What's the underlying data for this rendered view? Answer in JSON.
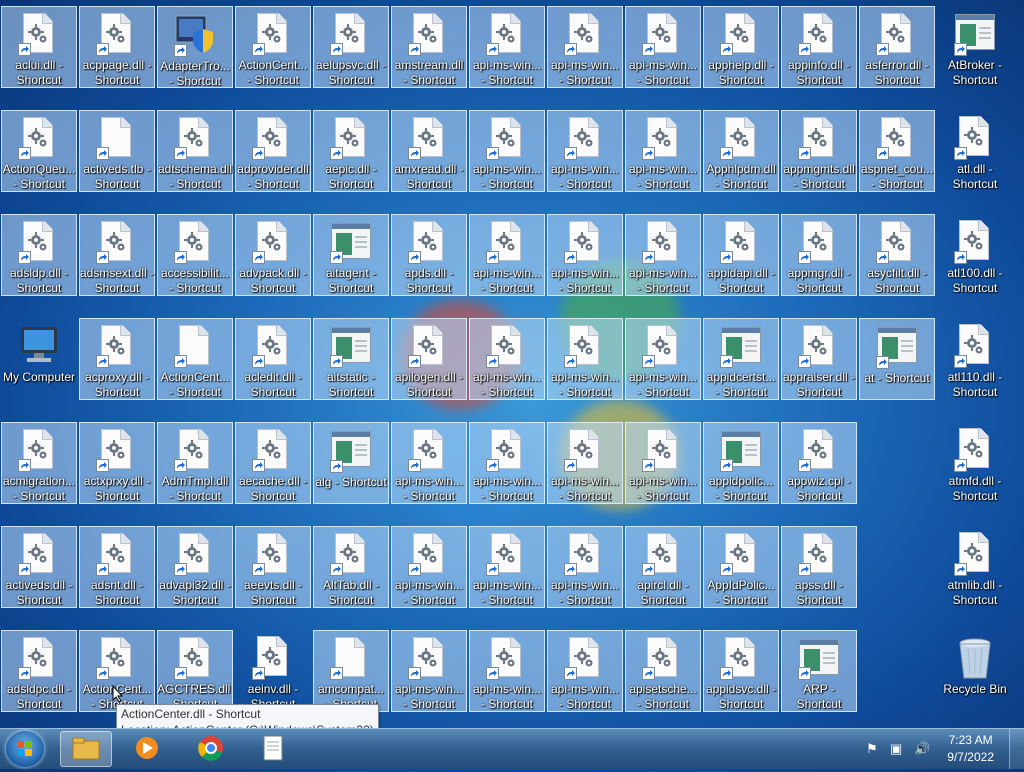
{
  "desktop": {
    "columns": [
      [
        {
          "name": "aclui.dll - Shortcut",
          "l1": "aclui.dll -",
          "l2": "Shortcut",
          "icon": "dll-gear",
          "sel": true
        },
        {
          "name": "ActionQueue... - Shortcut",
          "l1": "ActionQueu...",
          "l2": "- Shortcut",
          "icon": "dll-gear",
          "sel": true
        },
        {
          "name": "adsldp.dll - Shortcut",
          "l1": "adsldp.dll -",
          "l2": "Shortcut",
          "icon": "dll-gear",
          "sel": true
        },
        {
          "name": "My Computer",
          "l1": "My Computer",
          "l2": "",
          "icon": "computer",
          "sel": false,
          "noarrow": true
        },
        {
          "name": "acmigration... - Shortcut",
          "l1": "acmigration...",
          "l2": "- Shortcut",
          "icon": "dll-gear",
          "sel": true
        },
        {
          "name": "activeds.dll - Shortcut",
          "l1": "activeds.dll -",
          "l2": "Shortcut",
          "icon": "dll-gear",
          "sel": true
        },
        {
          "name": "adsldpc.dll - Shortcut",
          "l1": "adsldpc.dll -",
          "l2": "Shortcut",
          "icon": "dll-gear",
          "sel": true
        }
      ],
      [
        {
          "l1": "acppage.dll -",
          "l2": "Shortcut",
          "icon": "dll-gear",
          "sel": true
        },
        {
          "l1": "activeds.tlb -",
          "l2": "Shortcut",
          "icon": "blank",
          "sel": true
        },
        {
          "l1": "adsmsext.dll -",
          "l2": "Shortcut",
          "icon": "dll-gear",
          "sel": true
        },
        {
          "l1": "acproxy.dll -",
          "l2": "Shortcut",
          "icon": "dll-gear",
          "sel": true
        },
        {
          "l1": "actxprxy.dll -",
          "l2": "Shortcut",
          "icon": "dll-gear",
          "sel": true
        },
        {
          "l1": "adsnt.dll -",
          "l2": "Shortcut",
          "icon": "dll-gear",
          "sel": true
        },
        {
          "l1": "ActionCent...",
          "l2": "- Shortcut",
          "icon": "dll-gear",
          "sel": true
        }
      ],
      [
        {
          "l1": "AdapterTro...",
          "l2": "- Shortcut",
          "icon": "shield",
          "sel": true
        },
        {
          "l1": "adtschema.dll",
          "l2": "- Shortcut",
          "icon": "dll-gear",
          "sel": true
        },
        {
          "l1": "accessibilit...",
          "l2": "- Shortcut",
          "icon": "dll-gear",
          "sel": true
        },
        {
          "l1": "ActionCent...",
          "l2": "- Shortcut",
          "icon": "blank",
          "sel": true
        },
        {
          "l1": "AdmTmpl.dll",
          "l2": "- Shortcut",
          "icon": "dll-gear",
          "sel": true
        },
        {
          "l1": "advapi32.dll -",
          "l2": "Shortcut",
          "icon": "dll-gear",
          "sel": true
        },
        {
          "l1": "AGCTRES.dll -",
          "l2": "Shortcut",
          "icon": "dll-gear",
          "sel": true
        }
      ],
      [
        {
          "l1": "ActionCent...",
          "l2": "- Shortcut",
          "icon": "dll-gear",
          "sel": true
        },
        {
          "l1": "adprovider.dll",
          "l2": "- Shortcut",
          "icon": "dll-gear",
          "sel": true
        },
        {
          "l1": "advpack.dll -",
          "l2": "Shortcut",
          "icon": "dll-gear",
          "sel": true
        },
        {
          "l1": "acledit.dll -",
          "l2": "Shortcut",
          "icon": "dll-gear",
          "sel": true
        },
        {
          "l1": "aecache.dll -",
          "l2": "Shortcut",
          "icon": "dll-gear",
          "sel": true
        },
        {
          "l1": "aeevts.dll -",
          "l2": "Shortcut",
          "icon": "dll-gear",
          "sel": true
        },
        {
          "l1": "aeinv.dll -",
          "l2": "Shortcut",
          "icon": "dll-gear",
          "sel": false
        }
      ],
      [
        {
          "l1": "aelupsvc.dll -",
          "l2": "Shortcut",
          "icon": "dll-gear",
          "sel": true
        },
        {
          "l1": "aepic.dll -",
          "l2": "Shortcut",
          "icon": "dll-gear",
          "sel": true
        },
        {
          "l1": "aitagent -",
          "l2": "Shortcut",
          "icon": "window",
          "sel": true
        },
        {
          "l1": "aitstatic -",
          "l2": "Shortcut",
          "icon": "window",
          "sel": true
        },
        {
          "l1": "alg - Shortcut",
          "l2": "",
          "icon": "window",
          "sel": true
        },
        {
          "l1": "AltTab.dll -",
          "l2": "Shortcut",
          "icon": "dll-gear",
          "sel": true
        },
        {
          "l1": "amcompat...",
          "l2": "- Shortcut",
          "icon": "blank",
          "sel": true
        }
      ],
      [
        {
          "l1": "amstream.dll",
          "l2": "- Shortcut",
          "icon": "dll-gear",
          "sel": true
        },
        {
          "l1": "amxread.dll -",
          "l2": "Shortcut",
          "icon": "dll-gear",
          "sel": true
        },
        {
          "l1": "apds.dll -",
          "l2": "Shortcut",
          "icon": "dll-gear",
          "sel": true
        },
        {
          "l1": "apilogen.dll -",
          "l2": "Shortcut",
          "icon": "dll-gear",
          "sel": true
        },
        {
          "l1": "api-ms-win...",
          "l2": "- Shortcut",
          "icon": "dll-gear",
          "sel": true
        },
        {
          "l1": "api-ms-win...",
          "l2": "- Shortcut",
          "icon": "dll-gear",
          "sel": true
        },
        {
          "l1": "api-ms-win...",
          "l2": "- Shortcut",
          "icon": "dll-gear",
          "sel": true
        }
      ],
      [
        {
          "l1": "api-ms-win...",
          "l2": "- Shortcut",
          "icon": "dll-gear",
          "sel": true
        },
        {
          "l1": "api-ms-win...",
          "l2": "- Shortcut",
          "icon": "dll-gear",
          "sel": true
        },
        {
          "l1": "api-ms-win...",
          "l2": "- Shortcut",
          "icon": "dll-gear",
          "sel": true
        },
        {
          "l1": "api-ms-win...",
          "l2": "- Shortcut",
          "icon": "dll-gear",
          "sel": true
        },
        {
          "l1": "api-ms-win...",
          "l2": "- Shortcut",
          "icon": "dll-gear",
          "sel": true
        },
        {
          "l1": "api-ms-win...",
          "l2": "- Shortcut",
          "icon": "dll-gear",
          "sel": true
        },
        {
          "l1": "api-ms-win...",
          "l2": "- Shortcut",
          "icon": "dll-gear",
          "sel": true
        }
      ],
      [
        {
          "l1": "api-ms-win...",
          "l2": "- Shortcut",
          "icon": "dll-gear",
          "sel": true
        },
        {
          "l1": "api-ms-win...",
          "l2": "- Shortcut",
          "icon": "dll-gear",
          "sel": true
        },
        {
          "l1": "api-ms-win...",
          "l2": "- Shortcut",
          "icon": "dll-gear",
          "sel": true
        },
        {
          "l1": "api-ms-win...",
          "l2": "- Shortcut",
          "icon": "dll-gear",
          "sel": true
        },
        {
          "l1": "api-ms-win...",
          "l2": "- Shortcut",
          "icon": "dll-gear",
          "sel": true
        },
        {
          "l1": "api-ms-win...",
          "l2": "- Shortcut",
          "icon": "dll-gear",
          "sel": true
        },
        {
          "l1": "api-ms-win...",
          "l2": "- Shortcut",
          "icon": "dll-gear",
          "sel": true
        }
      ],
      [
        {
          "l1": "api-ms-win...",
          "l2": "- Shortcut",
          "icon": "dll-gear",
          "sel": true
        },
        {
          "l1": "api-ms-win...",
          "l2": "- Shortcut",
          "icon": "dll-gear",
          "sel": true
        },
        {
          "l1": "api-ms-win...",
          "l2": "- Shortcut",
          "icon": "dll-gear",
          "sel": true
        },
        {
          "l1": "api-ms-win...",
          "l2": "- Shortcut",
          "icon": "dll-gear",
          "sel": true
        },
        {
          "l1": "api-ms-win...",
          "l2": "- Shortcut",
          "icon": "dll-gear",
          "sel": true
        },
        {
          "l1": "apircl.dll -",
          "l2": "Shortcut",
          "icon": "dll-gear",
          "sel": true
        },
        {
          "l1": "apisetsche...",
          "l2": "- Shortcut",
          "icon": "dll-gear",
          "sel": true
        }
      ],
      [
        {
          "l1": "apphelp.dll -",
          "l2": "Shortcut",
          "icon": "dll-gear",
          "sel": true
        },
        {
          "l1": "Apphlpdm.dll",
          "l2": "- Shortcut",
          "icon": "dll-gear",
          "sel": true
        },
        {
          "l1": "appidapi.dll -",
          "l2": "Shortcut",
          "icon": "dll-gear",
          "sel": true
        },
        {
          "l1": "appidcertst...",
          "l2": "- Shortcut",
          "icon": "window",
          "sel": true
        },
        {
          "l1": "appidpolic...",
          "l2": "- Shortcut",
          "icon": "window",
          "sel": true
        },
        {
          "l1": "AppIdPolic...",
          "l2": "- Shortcut",
          "icon": "dll-gear",
          "sel": true
        },
        {
          "l1": "appidsvc.dll -",
          "l2": "Shortcut",
          "icon": "dll-gear",
          "sel": true
        }
      ],
      [
        {
          "l1": "appinfo.dll -",
          "l2": "Shortcut",
          "icon": "dll-gear",
          "sel": true
        },
        {
          "l1": "appmgmts.dll",
          "l2": "- Shortcut",
          "icon": "dll-gear",
          "sel": true
        },
        {
          "l1": "appmgr.dll -",
          "l2": "Shortcut",
          "icon": "dll-gear",
          "sel": true
        },
        {
          "l1": "appraiser.dll -",
          "l2": "Shortcut",
          "icon": "dll-gear",
          "sel": true
        },
        {
          "l1": "appwiz.cpl -",
          "l2": "Shortcut",
          "icon": "dll-gear",
          "sel": true
        },
        {
          "l1": "apss.dll -",
          "l2": "Shortcut",
          "icon": "dll-gear",
          "sel": true
        },
        {
          "l1": "ARP -",
          "l2": "Shortcut",
          "icon": "window",
          "sel": true
        }
      ],
      [
        {
          "l1": "asferror.dll -",
          "l2": "Shortcut",
          "icon": "dll-gear",
          "sel": true
        },
        {
          "l1": "aspnet_cou...",
          "l2": "- Shortcut",
          "icon": "dll-gear",
          "sel": true
        },
        {
          "l1": "asycfilt.dll -",
          "l2": "Shortcut",
          "icon": "dll-gear",
          "sel": true
        },
        {
          "l1": "at - Shortcut",
          "l2": "",
          "icon": "window",
          "sel": true
        }
      ],
      [
        {
          "l1": "AtBroker -",
          "l2": "Shortcut",
          "icon": "window",
          "sel": false
        },
        {
          "l1": "atl.dll -",
          "l2": "Shortcut",
          "icon": "dll-gear",
          "sel": false
        },
        {
          "l1": "atl100.dll -",
          "l2": "Shortcut",
          "icon": "dll-gear",
          "sel": false
        },
        {
          "l1": "atl110.dll -",
          "l2": "Shortcut",
          "icon": "dll-gear",
          "sel": false
        },
        {
          "l1": "atmfd.dll -",
          "l2": "Shortcut",
          "icon": "dll-gear",
          "sel": false
        },
        {
          "l1": "atmlib.dll -",
          "l2": "Shortcut",
          "icon": "dll-gear",
          "sel": false
        },
        {
          "l1": "Recycle Bin",
          "l2": "",
          "icon": "recycle",
          "sel": false,
          "noarrow": true
        }
      ]
    ]
  },
  "tooltip": {
    "line1": "ActionCenter.dll - Shortcut",
    "line2": "Location: ActionCenter (C:\\Windows\\System32)"
  },
  "taskbar": {
    "start_label": "Start",
    "time": "7:23 AM",
    "date": "9/7/2022"
  },
  "colors": {
    "desktop_bg": "#1f6fbe",
    "selection": "#bedcfa",
    "taskbar": "#315f8f"
  }
}
